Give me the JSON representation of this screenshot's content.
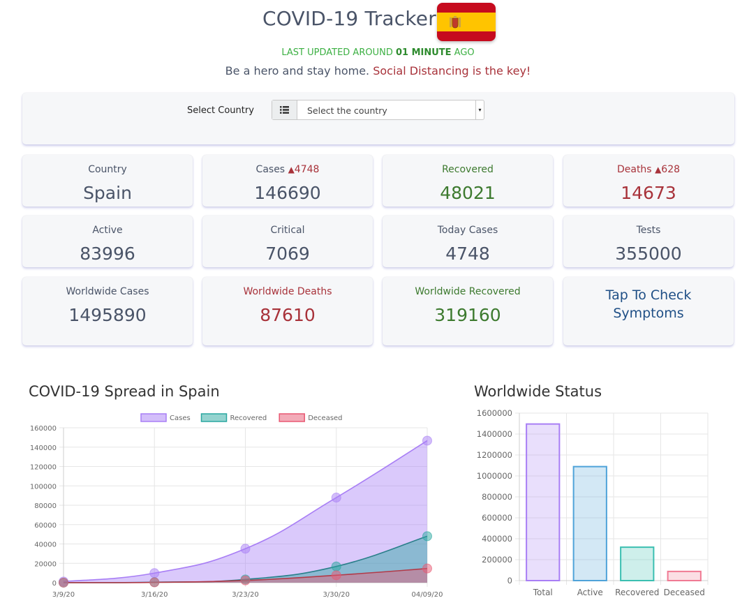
{
  "header": {
    "title": "COVID-19 Tracker",
    "updated_prefix": "LAST UPDATED AROUND ",
    "updated_value": "01 MINUTE",
    "updated_suffix": " AGO",
    "tagline_main": "Be a hero and stay home. ",
    "tagline_red": "Social Distancing is the key!",
    "flag_icon": "spain-flag-icon"
  },
  "selector": {
    "label": "Select Country",
    "placeholder": "Select the country",
    "icon": "list-icon"
  },
  "cards": {
    "country": {
      "label": "Country",
      "value": "Spain"
    },
    "cases": {
      "label": "Cases ",
      "delta": "4748",
      "value": "146690"
    },
    "recovered": {
      "label": "Recovered",
      "value": "48021"
    },
    "deaths": {
      "label": "Deaths ",
      "delta": "628",
      "value": "14673"
    },
    "active": {
      "label": "Active",
      "value": "83996"
    },
    "critical": {
      "label": "Critical",
      "value": "7069"
    },
    "today_cases": {
      "label": "Today Cases",
      "value": "4748"
    },
    "tests": {
      "label": "Tests",
      "value": "355000"
    },
    "world_cases": {
      "label": "Worldwide Cases",
      "value": "1495890"
    },
    "world_deaths": {
      "label": "Worldwide Deaths",
      "value": "87610"
    },
    "world_recovered": {
      "label": "Worldwide Recovered",
      "value": "319160"
    },
    "symptoms": {
      "line1": "Tap To Check",
      "line2": "Symptoms"
    }
  },
  "colors": {
    "cases": "#a87ef5",
    "recovered": "#2aa7a0",
    "deceased": "#e85872",
    "green": "#3d7a2f",
    "red": "#a8323a"
  },
  "chart_data": [
    {
      "type": "area",
      "title": "COVID-19 Spread in Spain",
      "x": [
        "3/9/20",
        "3/16/20",
        "3/23/20",
        "3/30/20",
        "04/09/20"
      ],
      "ylim": [
        0,
        160000
      ],
      "yticks": [
        0,
        20000,
        40000,
        60000,
        80000,
        100000,
        120000,
        140000,
        160000
      ],
      "series": [
        {
          "name": "Cases",
          "values": [
            1200,
            9900,
            35100,
            87900,
            146690
          ]
        },
        {
          "name": "Recovered",
          "values": [
            30,
            530,
            3350,
            16800,
            48021
          ]
        },
        {
          "name": "Deceased",
          "values": [
            30,
            340,
            2300,
            7700,
            14673
          ]
        }
      ],
      "legend": "top-center",
      "grid": true
    },
    {
      "type": "bar",
      "title": "Worldwide Status",
      "categories": [
        "Total",
        "Active",
        "Recovered",
        "Deceased"
      ],
      "values": [
        1495890,
        1089120,
        319160,
        87610
      ],
      "ylim": [
        0,
        1600000
      ],
      "yticks": [
        0,
        200000,
        400000,
        600000,
        800000,
        1000000,
        1200000,
        1400000,
        1600000
      ],
      "grid": true
    }
  ]
}
